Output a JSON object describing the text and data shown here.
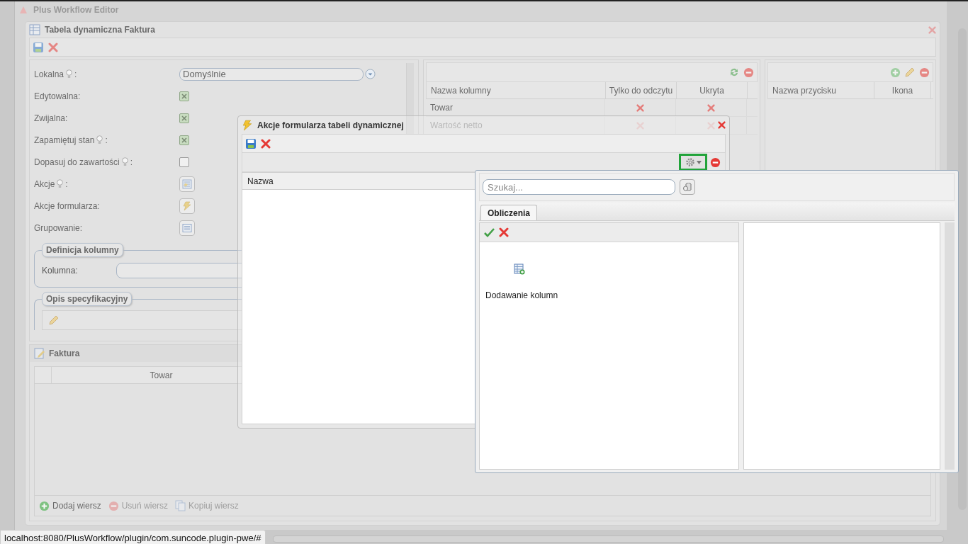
{
  "background": {
    "app_title": "Plus Workflow Editor"
  },
  "main_window": {
    "title": "Tabela dynamiczna Faktura",
    "form": [
      {
        "kind": "select",
        "label": "Lokalna",
        "hint": true,
        "suffix": ":",
        "value": "Domyślnie"
      },
      {
        "kind": "checkbox",
        "label": "Edytowalna:",
        "hint": false,
        "checked": true
      },
      {
        "kind": "checkbox",
        "label": "Zwijalna:",
        "hint": false,
        "checked": true
      },
      {
        "kind": "checkbox",
        "label": "Zapamiętuj stan",
        "hint": true,
        "suffix": ":",
        "checked": true
      },
      {
        "kind": "checkbox",
        "label": "Dopasuj do zawartości",
        "hint": true,
        "suffix": ":",
        "checked": false
      },
      {
        "kind": "actions",
        "label": "Akcje",
        "hint": true,
        "suffix": ":"
      },
      {
        "kind": "lightning",
        "label": "Akcje formularza:",
        "hint": false
      },
      {
        "kind": "grouping",
        "label": "Grupowanie:",
        "hint": false
      }
    ],
    "column_definition": {
      "legend": "Definicja kolumny",
      "field_label": "Kolumna:"
    },
    "specification": {
      "legend": "Opis specyfikacyjny"
    },
    "columns_grid": {
      "headers": [
        "Nazwa kolumny",
        "Tylko do odczytu",
        "Ukryta"
      ],
      "rows": [
        {
          "name": "Towar",
          "read_only": false,
          "hidden": false
        },
        {
          "name": "Wartość netto",
          "read_only": false,
          "hidden": false
        }
      ]
    },
    "buttons_grid": {
      "headers": [
        "Nazwa przycisku",
        "Ikona"
      ]
    },
    "faktura": {
      "title": "Faktura",
      "columns": [
        "Towar"
      ],
      "actions": [
        {
          "kind": "add",
          "label": "Dodaj wiersz",
          "disabled": false
        },
        {
          "kind": "remove",
          "label": "Usuń wiersz",
          "disabled": true
        },
        {
          "kind": "copy",
          "label": "Kopiuj wiersz",
          "disabled": true
        }
      ]
    }
  },
  "actions_window": {
    "title": "Akcje formularza tabeli dynamicznej",
    "gear_button": {
      "highlighted": true
    },
    "columns": [
      "Nazwa"
    ]
  },
  "popup": {
    "search": {
      "placeholder": "Szukaj..."
    },
    "tabs": [
      {
        "label": "Obliczenia",
        "selected": true
      }
    ],
    "items": [
      {
        "label": "Dodawanie kolumn"
      }
    ]
  },
  "status_bar": {
    "url": "localhost:8080/PlusWorkflow/plugin/com.suncode.plugin-pwe/#"
  }
}
